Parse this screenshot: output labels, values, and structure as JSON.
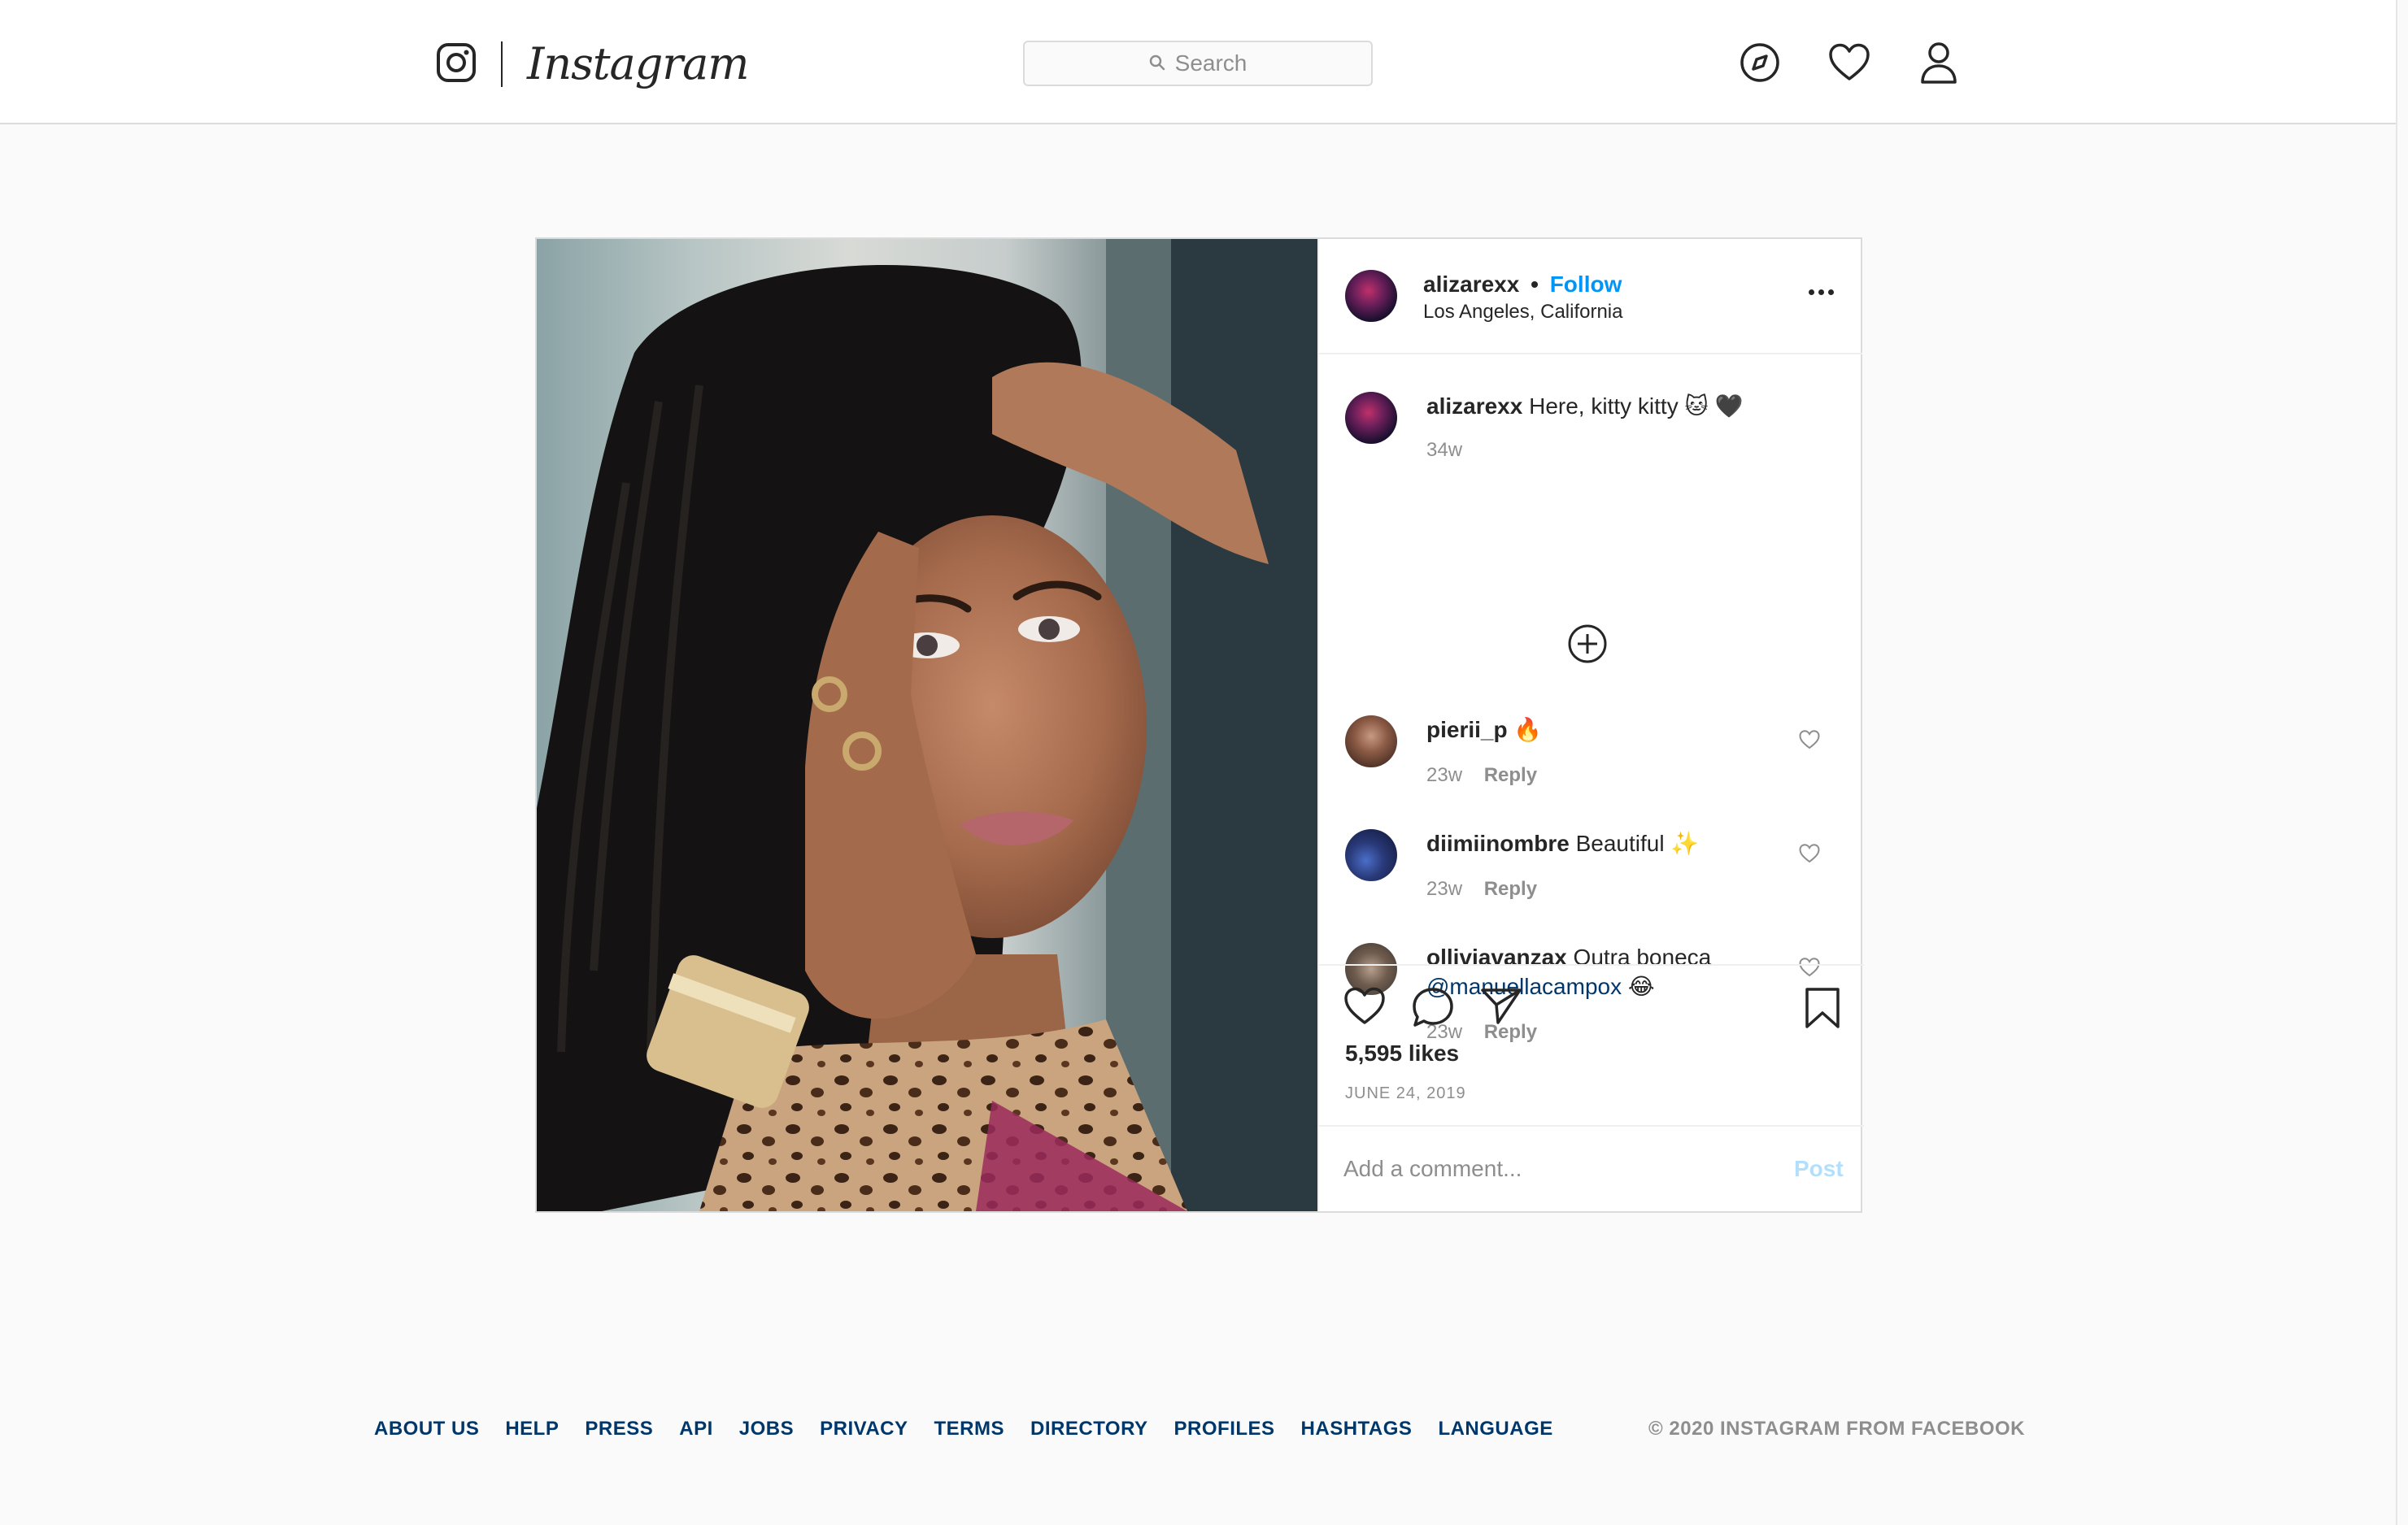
{
  "header": {
    "wordmark": "Instagram",
    "search": {
      "placeholder": "Search"
    }
  },
  "post": {
    "author": {
      "username": "alizarexx",
      "separator": "•",
      "follow_label": "Follow",
      "location": "Los Angeles, California"
    },
    "caption": {
      "username": "alizarexx",
      "text": "Here, kitty kitty 🐱 🖤",
      "time": "34w"
    },
    "comments": [
      {
        "username": "pierii_p",
        "text": "🔥",
        "time": "23w",
        "reply_label": "Reply"
      },
      {
        "username": "diimiinombre",
        "text": "Beautiful ✨",
        "time": "23w",
        "reply_label": "Reply"
      },
      {
        "username": "olliviavanzax",
        "text": "Outra boneca",
        "mention": "@manuellacampox",
        "emoji": "😂",
        "time": "23w",
        "reply_label": "Reply"
      }
    ],
    "likes": "5,595 likes",
    "date": "JUNE 24, 2019",
    "add_comment": {
      "placeholder": "Add a comment...",
      "post_label": "Post"
    }
  },
  "footer": {
    "links": [
      "ABOUT US",
      "HELP",
      "PRESS",
      "API",
      "JOBS",
      "PRIVACY",
      "TERMS",
      "DIRECTORY",
      "PROFILES",
      "HASHTAGS",
      "LANGUAGE"
    ],
    "copyright": "© 2020 INSTAGRAM FROM FACEBOOK"
  },
  "colors": {
    "accent": "#0095f6",
    "text": "#262626",
    "muted": "#8e8e8e",
    "mention": "#00376b"
  },
  "icons": {
    "logo": "instagram-camera-icon",
    "search": "search-icon",
    "explore": "compass-icon",
    "activity": "heart-icon",
    "profile": "person-icon",
    "more": "more-options-icon",
    "load_more": "plus-circle-icon",
    "like": "heart-icon",
    "comment": "comment-bubble-icon",
    "share": "paper-plane-icon",
    "save": "bookmark-icon"
  }
}
